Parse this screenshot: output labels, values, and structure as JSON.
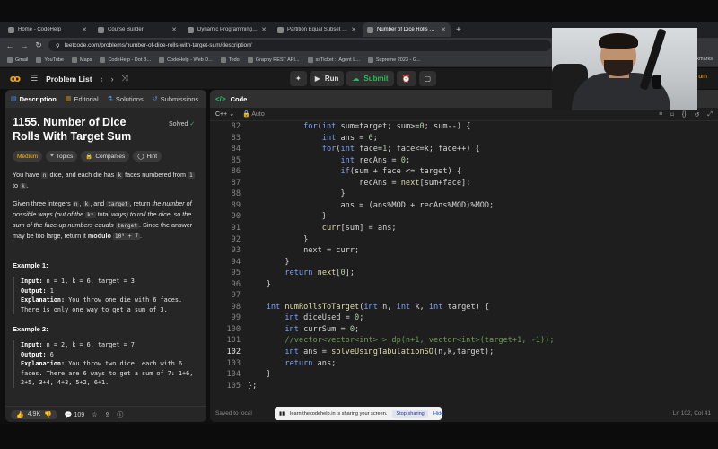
{
  "browser": {
    "tabs": [
      {
        "label": "Home - CodeHelp",
        "active": false
      },
      {
        "label": "Course Builder",
        "active": false
      },
      {
        "label": "Dynamic Programming Cl",
        "active": false
      },
      {
        "label": "Partition Equal Subset Sum -",
        "active": false
      },
      {
        "label": "Number of Dice Rolls With Ta",
        "active": true
      }
    ],
    "url": "leetcode.com/problems/number-of-dice-rolls-with-target-sum/description/",
    "bookmarks": [
      "Gmail",
      "YouTube",
      "Maps",
      "CodeHelp - Dot B...",
      "CodeHelp - Web D...",
      "Todo",
      "Graphy REST API...",
      "ssTicket :: Agent L...",
      "Supreme 2023 - G..."
    ],
    "bookmarks_end": "rkmarks"
  },
  "leetcode": {
    "problem_list": "Problem List",
    "run": "Run",
    "submit": "Submit",
    "premium_hint": "um"
  },
  "left_panel": {
    "tabs": [
      "Description",
      "Editorial",
      "Solutions",
      "Submissions"
    ],
    "title": "1155. Number of Dice Rolls With Target Sum",
    "solved": "Solved",
    "chips": [
      "Medium",
      "Topics",
      "Companies",
      "Hint"
    ],
    "p1_a": "You have ",
    "p1_n": "n",
    "p1_b": " dice, and each die has ",
    "p1_k": "k",
    "p1_c": " faces numbered from ",
    "p1_1": "1",
    "p1_d": " to ",
    "p1_k2": "k",
    "p1_e": ".",
    "p2_a": "Given three integers ",
    "p2_n": "n",
    "p2_b": ", ",
    "p2_k": "k",
    "p2_c": ", and ",
    "p2_t": "target",
    "p2_d": ", return ",
    "p2_e": "the number of possible ways (out of the ",
    "p2_kn": "kⁿ",
    "p2_f": " total ways) to roll the dice, so the sum of the face-up numbers equals ",
    "p2_t2": "target",
    "p2_g": ". Since the answer may be too large, return it ",
    "p2_h": "modulo",
    "p2_mod": "10⁹ + 7",
    "p2_i": ".",
    "example1": {
      "heading": "Example 1:",
      "input_label": "Input:",
      "input": " n = 1, k = 6, target = 3",
      "output_label": "Output:",
      "output": " 1",
      "expl_label": "Explanation:",
      "expl": " You throw one die with 6 faces. There is only one way to get a sum of 3."
    },
    "example2": {
      "heading": "Example 2:",
      "input_label": "Input:",
      "input": " n = 2, k = 6, target = 7",
      "output_label": "Output:",
      "output": " 6",
      "expl_label": "Explanation:",
      "expl": " You throw two dice, each with 6 faces. There are 6 ways to get a sum of 7: 1+6, 2+5, 3+4, 4+3, 5+2, 6+1."
    },
    "likes": "4.9K",
    "comments": "109"
  },
  "code_panel": {
    "title": "Code",
    "language": "C++",
    "mode": "Auto",
    "saved": "Saved to local",
    "cursor_pos": "Ln 102, Col 41",
    "current_line": 102
  },
  "code_lines": [
    {
      "n": "82",
      "html": "            <span class=\"kw\">for</span>(<span class=\"kw\">int</span> sum=target; sum&gt;=<span class=\"num\">0</span>; sum--) {"
    },
    {
      "n": "83",
      "html": "                <span class=\"kw\">int</span> ans = <span class=\"num\">0</span>;"
    },
    {
      "n": "84",
      "html": "                <span class=\"kw\">for</span>(<span class=\"kw\">int</span> face=<span class=\"num\">1</span>; face&lt;=k; face++) {"
    },
    {
      "n": "85",
      "html": "                    <span class=\"kw\">int</span> recAns = <span class=\"num\">0</span>;"
    },
    {
      "n": "86",
      "html": "                    <span class=\"kw\">if</span>(sum + face &lt;= target) {"
    },
    {
      "n": "87",
      "html": "                        recAns = <span class=\"fn\">next</span>[sum+face];"
    },
    {
      "n": "88",
      "html": "                    }"
    },
    {
      "n": "89",
      "html": "                    ans = (ans%MOD + recAns%MOD)%MOD;"
    },
    {
      "n": "90",
      "html": "                }"
    },
    {
      "n": "91",
      "html": "                <span class=\"fn\">curr</span>[sum] = ans;"
    },
    {
      "n": "92",
      "html": "            }"
    },
    {
      "n": "93",
      "html": "            next = curr;"
    },
    {
      "n": "94",
      "html": "        }"
    },
    {
      "n": "95",
      "html": "        <span class=\"kw\">return</span> <span class=\"fn\">next</span>[<span class=\"num\">0</span>];"
    },
    {
      "n": "96",
      "html": "    }"
    },
    {
      "n": "97",
      "html": ""
    },
    {
      "n": "98",
      "html": "    <span class=\"kw\">int</span> <span class=\"fn\">numRollsToTarget</span>(<span class=\"kw\">int</span> n, <span class=\"kw\">int</span> k, <span class=\"kw\">int</span> target) {"
    },
    {
      "n": "99",
      "html": "        <span class=\"kw\">int</span> diceUsed = <span class=\"num\">0</span>;"
    },
    {
      "n": "100",
      "html": "        <span class=\"kw\">int</span> currSum = <span class=\"num\">0</span>;"
    },
    {
      "n": "101",
      "html": "        <span class=\"cm\">//vector&lt;vector&lt;int&gt; &gt; dp(n+1, vector&lt;int&gt;(target+1, -1));</span>"
    },
    {
      "n": "102",
      "html": "        <span class=\"kw\">int</span> ans = <span class=\"fn\">solveUsingTabulationSO</span>(n,k,target);"
    },
    {
      "n": "103",
      "html": "        <span class=\"kw\">return</span> ans;"
    },
    {
      "n": "104",
      "html": "    }"
    },
    {
      "n": "105",
      "html": "};"
    }
  ],
  "share": {
    "text": "learn.thecodehelp.in is sharing your screen.",
    "stop": "Stop sharing",
    "hide": "Hide"
  },
  "colors": {
    "accent_green": "#2cbb5d",
    "medium": "#ffb800",
    "brand": "#f5a623"
  }
}
